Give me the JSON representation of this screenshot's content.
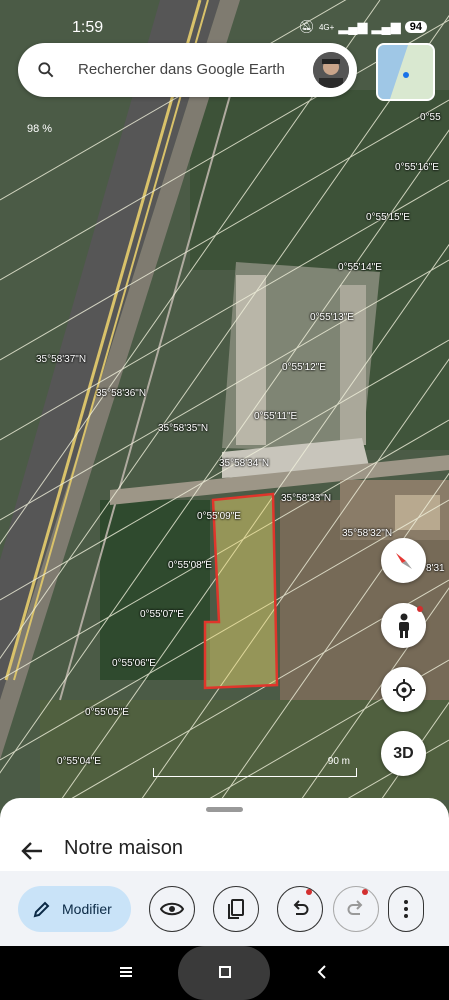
{
  "status_bar": {
    "time": "1:59",
    "network": "4G+",
    "battery": "94"
  },
  "search": {
    "placeholder": "Rechercher dans Google Earth"
  },
  "map": {
    "zoom_percent": "98 %",
    "scale_label": "90 m",
    "coordinate_labels": [
      "0°55",
      "0°55'16\"E",
      "0°55'15\"E",
      "0°55'14\"E",
      "0°55'13\"E",
      "0°55'12\"E",
      "0°55'11\"E",
      "35°58'37\"N",
      "35°58'36\"N",
      "35°58'35\"N",
      "35°58'34\"N",
      "35°58'33\"N",
      "35°58'32\"N",
      "0°55'09\"E",
      "0°55'08\"E",
      "0°55'07\"E",
      "0°55'06\"E",
      "0°55'05\"E",
      "0°55'04\"E",
      "8'31"
    ],
    "polygon_color": "#e0352b"
  },
  "map_controls": {
    "three_d_label": "3D"
  },
  "sheet": {
    "title": "Notre maison",
    "modifier_label": "Modifier"
  },
  "colors": {
    "accent_button": "#c9e3f8",
    "notification_dot": "#d32f2f"
  }
}
